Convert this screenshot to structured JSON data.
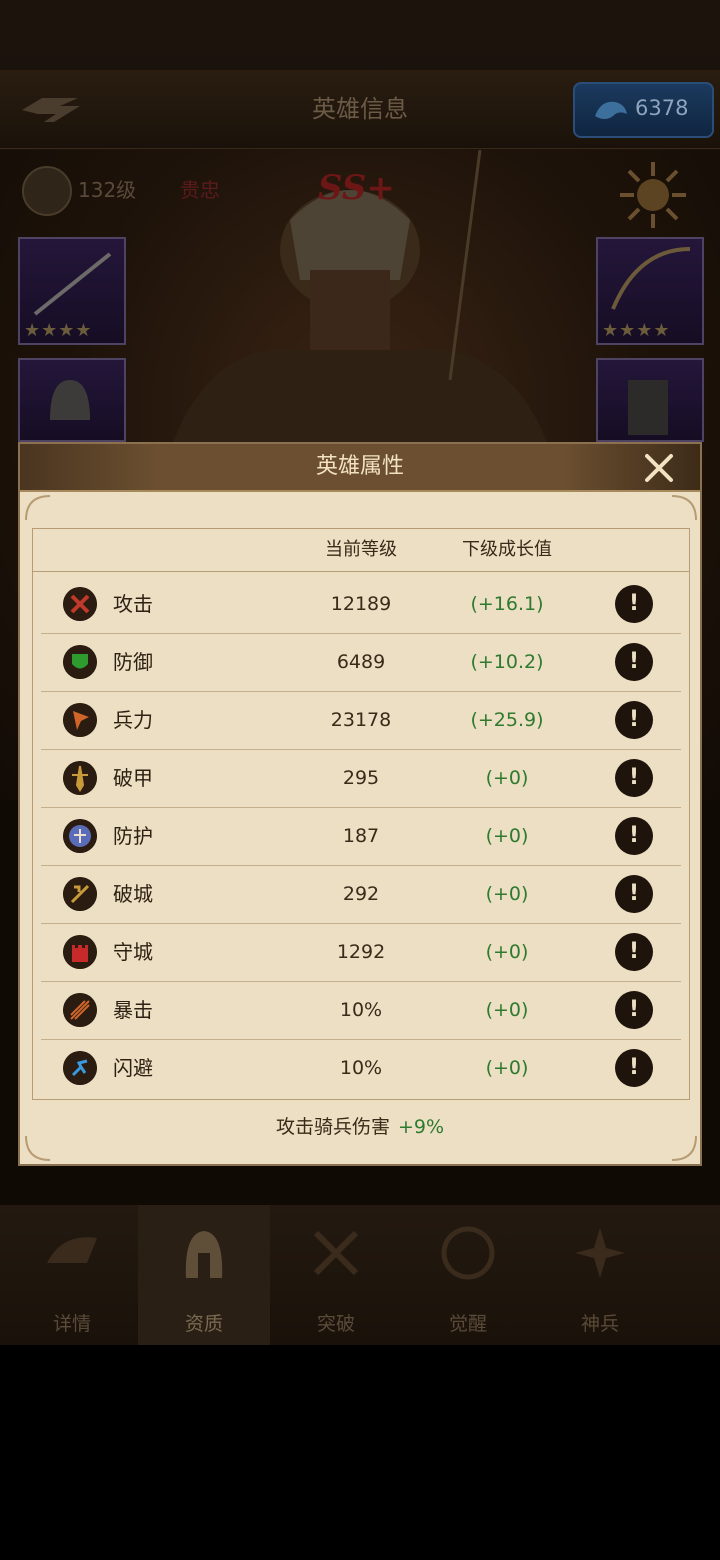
{
  "header": {
    "title": "英雄信息",
    "gems": "6378"
  },
  "hero": {
    "level": "132级",
    "status": "贵忠",
    "rank": "SS+",
    "equip_stars": [
      "★★★★",
      "★★★★"
    ]
  },
  "modal": {
    "title": "英雄属性",
    "col_current": "当前等级",
    "col_next": "下级成长值",
    "rows": [
      {
        "name": "攻击",
        "current": "12189",
        "next": "(+16.1)",
        "icon": "attack-icon",
        "color": "#a52a1e"
      },
      {
        "name": "防御",
        "current": "6489",
        "next": "(+10.2)",
        "icon": "defense-icon",
        "color": "#2e8b2e"
      },
      {
        "name": "兵力",
        "current": "23178",
        "next": "(+25.9)",
        "icon": "troops-icon",
        "color": "#c25a1e"
      },
      {
        "name": "破甲",
        "current": "295",
        "next": "(+0)",
        "icon": "armor-break-icon",
        "color": "#b8862c"
      },
      {
        "name": "防护",
        "current": "187",
        "next": "(+0)",
        "icon": "protection-icon",
        "color": "#4d5fa8"
      },
      {
        "name": "破城",
        "current": "292",
        "next": "(+0)",
        "icon": "siege-icon",
        "color": "#b8862c"
      },
      {
        "name": "守城",
        "current": "1292",
        "next": "(+0)",
        "icon": "city-defense-icon",
        "color": "#b82020"
      },
      {
        "name": "暴击",
        "current": "10%",
        "next": "(+0)",
        "icon": "critical-icon",
        "color": "#c25a1e"
      },
      {
        "name": "闪避",
        "current": "10%",
        "next": "(+0)",
        "icon": "dodge-icon",
        "color": "#2a7fc2"
      }
    ],
    "bonus_label": "攻击骑兵伤害",
    "bonus_value": "+9%"
  },
  "nav": [
    {
      "label": "详情",
      "icon": "details-icon"
    },
    {
      "label": "资质",
      "icon": "helmet-icon"
    },
    {
      "label": "突破",
      "icon": "breakthrough-icon"
    },
    {
      "label": "觉醒",
      "icon": "awaken-icon"
    },
    {
      "label": "神兵",
      "icon": "divine-weapon-icon"
    }
  ]
}
